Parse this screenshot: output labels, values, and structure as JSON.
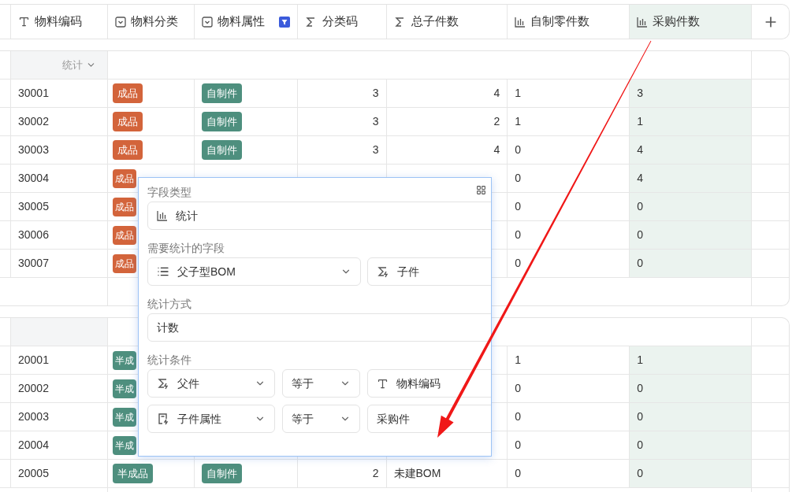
{
  "columns": [
    {
      "kind": "text",
      "label": "物料编码",
      "filtered": false,
      "selected": false
    },
    {
      "kind": "select",
      "label": "物料分类",
      "filtered": false,
      "selected": false
    },
    {
      "kind": "select",
      "label": "物料属性",
      "filtered": true,
      "selected": false
    },
    {
      "kind": "formula",
      "label": "分类码",
      "filtered": false,
      "selected": false
    },
    {
      "kind": "formula",
      "label": "总子件数",
      "filtered": false,
      "selected": false
    },
    {
      "kind": "stat",
      "label": "自制零件数",
      "filtered": false,
      "selected": false
    },
    {
      "kind": "stat",
      "label": "采购件数",
      "filtered": false,
      "selected": true
    }
  ],
  "groups": [
    {
      "stats_label": "统计",
      "rows": [
        {
          "code": "30001",
          "category": {
            "label": "成品",
            "color": "#d3643b"
          },
          "attribute": {
            "label": "自制件",
            "color": "#4e8f7e"
          },
          "class_code": "3",
          "total": "4",
          "self_made": "1",
          "purchased": "3"
        },
        {
          "code": "30002",
          "category": {
            "label": "成品",
            "color": "#d3643b"
          },
          "attribute": {
            "label": "自制件",
            "color": "#4e8f7e"
          },
          "class_code": "3",
          "total": "2",
          "self_made": "1",
          "purchased": "1"
        },
        {
          "code": "30003",
          "category": {
            "label": "成品",
            "color": "#d3643b"
          },
          "attribute": {
            "label": "自制件",
            "color": "#4e8f7e"
          },
          "class_code": "3",
          "total": "4",
          "self_made": "0",
          "purchased": "4"
        },
        {
          "code": "30004",
          "category": {
            "label": "成品",
            "color": "#d3643b"
          },
          "self_made": "0",
          "purchased": "4"
        },
        {
          "code": "30005",
          "category": {
            "label": "成品",
            "color": "#d3643b"
          },
          "self_made": "0",
          "purchased": "0"
        },
        {
          "code": "30006",
          "category": {
            "label": "成品",
            "color": "#d3643b"
          },
          "self_made": "0",
          "purchased": "0"
        },
        {
          "code": "30007",
          "category": {
            "label": "成品",
            "color": "#d3643b"
          },
          "self_made": "0",
          "purchased": "0"
        }
      ]
    },
    {
      "rows": [
        {
          "code": "20001",
          "category": {
            "label": "半成",
            "color": "#4e8f7e"
          },
          "self_made": "1",
          "purchased": "1"
        },
        {
          "code": "20002",
          "category": {
            "label": "半成",
            "color": "#4e8f7e"
          },
          "self_made": "0",
          "purchased": "0"
        },
        {
          "code": "20003",
          "category": {
            "label": "半成",
            "color": "#4e8f7e"
          },
          "self_made": "0",
          "purchased": "0"
        },
        {
          "code": "20004",
          "category": {
            "label": "半成",
            "color": "#4e8f7e"
          },
          "self_made": "0",
          "purchased": "0"
        },
        {
          "code": "20005",
          "category": {
            "label": "半成品",
            "color": "#4e8f7e"
          },
          "attribute": {
            "label": "自制件",
            "color": "#4e8f7e"
          },
          "class_code": "2",
          "total": "未建BOM",
          "total_note": true,
          "self_made": "0",
          "purchased": "0"
        }
      ]
    }
  ],
  "popup": {
    "sections": [
      {
        "label": "字段类型",
        "fields": [
          {
            "kind": "stat",
            "value": "统计"
          }
        ]
      },
      {
        "label": "需要统计的字段",
        "fields": [
          {
            "kind": "list",
            "value": "父子型BOM",
            "dropdown": true
          },
          {
            "kind": "formula",
            "value": "子件",
            "dropdown": false
          }
        ]
      },
      {
        "label": "统计方式",
        "fields": [
          {
            "kind": "plain",
            "value": "计数"
          }
        ]
      },
      {
        "label": "统计条件",
        "condition_rows": [
          [
            {
              "kind": "formula",
              "value": "父件",
              "dropdown": true
            },
            {
              "kind": "plain",
              "value": "等于",
              "dropdown": true
            },
            {
              "kind": "text",
              "value": "物料编码",
              "dropdown": false
            }
          ],
          [
            {
              "kind": "doc",
              "value": "子件属性",
              "dropdown": true
            },
            {
              "kind": "plain",
              "value": "等于",
              "dropdown": true
            },
            {
              "kind": "plain",
              "value": "采购件",
              "dropdown": false
            }
          ]
        ]
      }
    ]
  }
}
